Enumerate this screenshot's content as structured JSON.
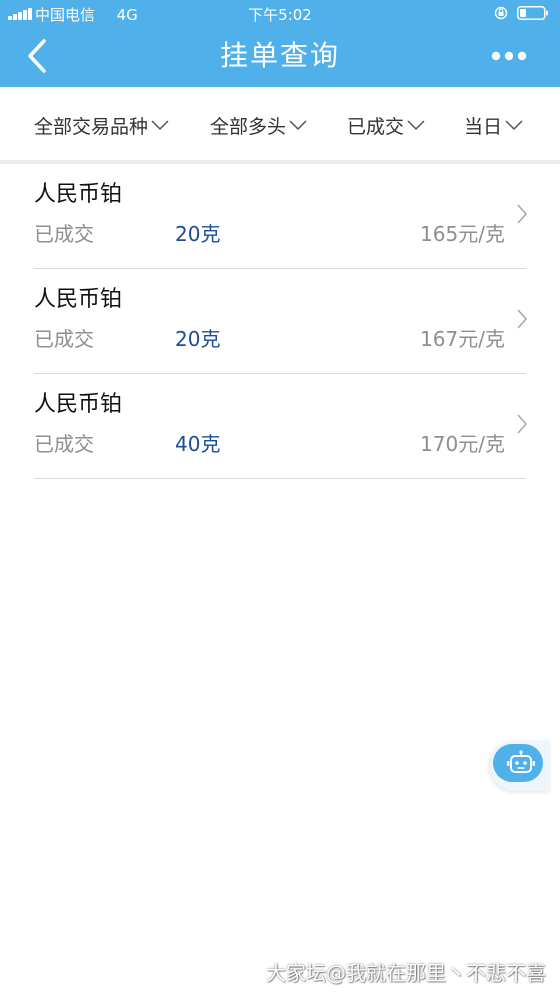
{
  "status_bar": {
    "carrier": "中国电信",
    "network": "4G",
    "time": "下午5:02",
    "icons": [
      "signal-icon",
      "orientation-lock-icon",
      "battery-icon"
    ]
  },
  "nav": {
    "title": "挂单查询",
    "back_icon": "chevron-left-icon",
    "more_icon": "more-dots-icon",
    "background_color": "#4fb0ea"
  },
  "filters": [
    {
      "label": "全部交易品种"
    },
    {
      "label": "全部多头"
    },
    {
      "label": "已成交"
    },
    {
      "label": "当日"
    }
  ],
  "orders": [
    {
      "name": "人民币铂",
      "status": "已成交",
      "quantity": "20克",
      "price": "165元/克"
    },
    {
      "name": "人民币铂",
      "status": "已成交",
      "quantity": "20克",
      "price": "167元/克"
    },
    {
      "name": "人民币铂",
      "status": "已成交",
      "quantity": "40克",
      "price": "170元/克"
    }
  ],
  "colors": {
    "accent": "#4fb0ea",
    "quantity_text": "#1c4d96",
    "secondary_text": "#8e8e93"
  },
  "floating_button": {
    "icon": "robot-icon"
  },
  "watermark": "大家坛@我就在那里丶不悲不喜"
}
